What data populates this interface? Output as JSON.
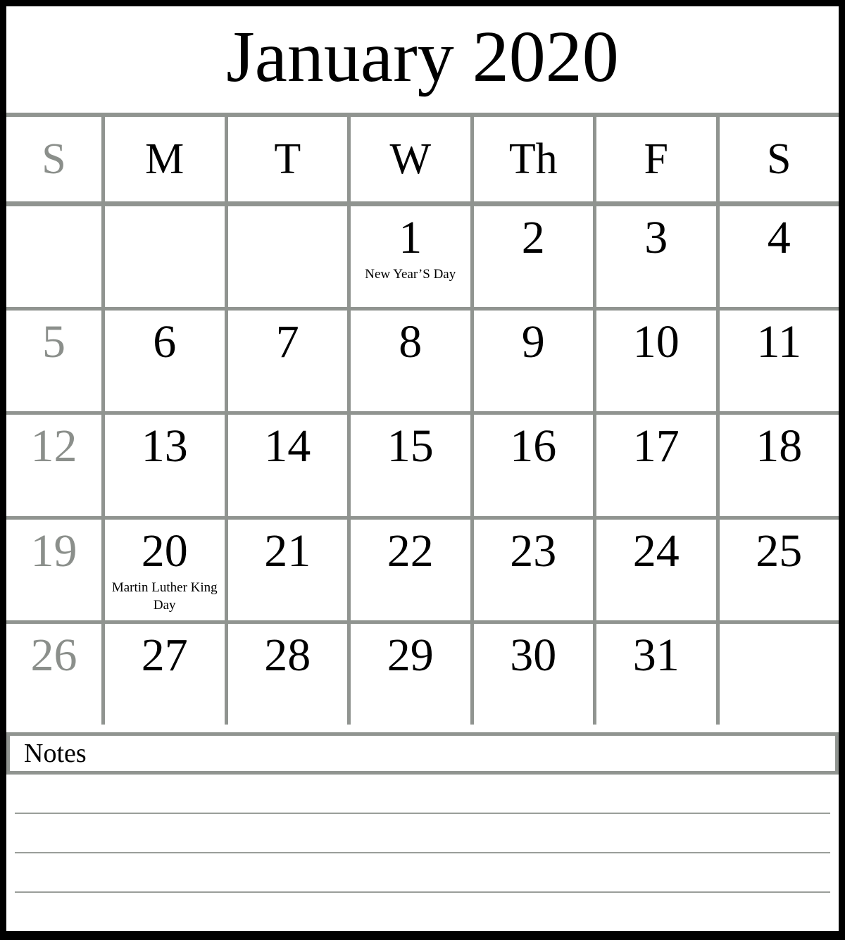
{
  "calendar": {
    "title": "January 2020",
    "month": "January",
    "year": "2020",
    "weekday_headers": [
      {
        "label": "S",
        "muted": true
      },
      {
        "label": "M",
        "muted": false
      },
      {
        "label": "T",
        "muted": false
      },
      {
        "label": "W",
        "muted": false
      },
      {
        "label": "Th",
        "muted": false
      },
      {
        "label": "F",
        "muted": false
      },
      {
        "label": "S",
        "muted": false
      }
    ],
    "weeks": [
      [
        {
          "day": "",
          "note": ""
        },
        {
          "day": "",
          "note": ""
        },
        {
          "day": "",
          "note": ""
        },
        {
          "day": "1",
          "note": "New Year’S Day"
        },
        {
          "day": "2",
          "note": ""
        },
        {
          "day": "3",
          "note": ""
        },
        {
          "day": "4",
          "note": ""
        }
      ],
      [
        {
          "day": "5",
          "note": ""
        },
        {
          "day": "6",
          "note": ""
        },
        {
          "day": "7",
          "note": ""
        },
        {
          "day": "8",
          "note": ""
        },
        {
          "day": "9",
          "note": ""
        },
        {
          "day": "10",
          "note": ""
        },
        {
          "day": "11",
          "note": ""
        }
      ],
      [
        {
          "day": "12",
          "note": ""
        },
        {
          "day": "13",
          "note": ""
        },
        {
          "day": "14",
          "note": ""
        },
        {
          "day": "15",
          "note": ""
        },
        {
          "day": "16",
          "note": ""
        },
        {
          "day": "17",
          "note": ""
        },
        {
          "day": "18",
          "note": ""
        }
      ],
      [
        {
          "day": "19",
          "note": ""
        },
        {
          "day": "20",
          "note": "Martin Luther King Day"
        },
        {
          "day": "21",
          "note": ""
        },
        {
          "day": "22",
          "note": ""
        },
        {
          "day": "23",
          "note": ""
        },
        {
          "day": "24",
          "note": ""
        },
        {
          "day": "25",
          "note": ""
        }
      ],
      [
        {
          "day": "26",
          "note": ""
        },
        {
          "day": "27",
          "note": ""
        },
        {
          "day": "28",
          "note": ""
        },
        {
          "day": "29",
          "note": ""
        },
        {
          "day": "30",
          "note": ""
        },
        {
          "day": "31",
          "note": ""
        },
        {
          "day": "",
          "note": ""
        }
      ]
    ]
  },
  "notes": {
    "title": "Notes",
    "line_count": 4
  },
  "colors": {
    "frame": "#000000",
    "grid": "#909490",
    "text": "#000000",
    "muted_text": "#8b8f8b",
    "rule": "#9a9e9a",
    "background": "#ffffff"
  }
}
